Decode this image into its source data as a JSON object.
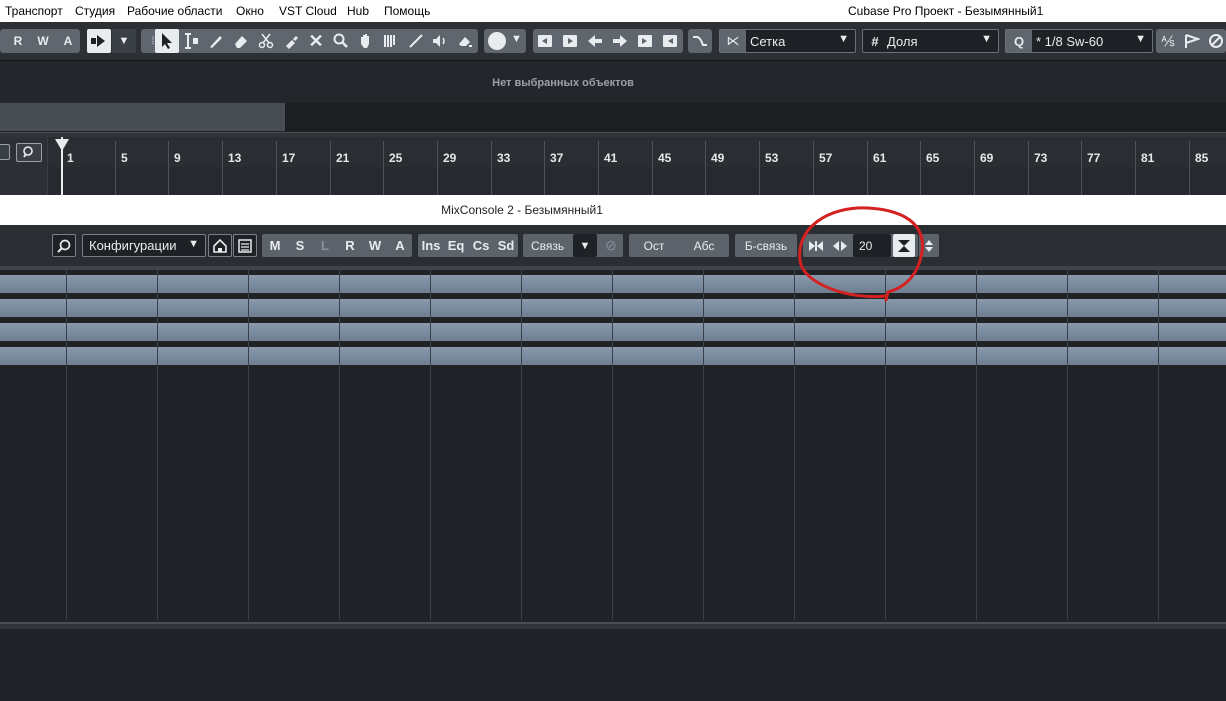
{
  "menubar": {
    "items": [
      "Транспорт",
      "Студия",
      "Рабочие области",
      "Окно",
      "VST Cloud",
      "Hub",
      "Помощь"
    ],
    "app_title": "Cubase Pro Проект - Безымянный1"
  },
  "toolbar": {
    "rwa": [
      "R",
      "W",
      "A"
    ],
    "grid_type": "Сетка",
    "grid_value": "Доля",
    "quantize_value": "* 1/8  Sw-60",
    "icons": [
      "arrow-icon",
      "range-icon",
      "pencil-icon",
      "eraser-icon",
      "scissors-icon",
      "glue-icon",
      "mute-x-icon",
      "zoom-icon",
      "hand-icon",
      "comp-icon",
      "line-icon",
      "speaker-icon",
      "color-icon"
    ]
  },
  "info_line": {
    "text": "Нет выбранных объектов"
  },
  "ruler": {
    "bars": [
      "1",
      "5",
      "9",
      "13",
      "17",
      "21",
      "25",
      "29",
      "33",
      "37",
      "41",
      "45",
      "49",
      "53",
      "57",
      "61",
      "65",
      "69",
      "73",
      "77",
      "81",
      "85"
    ]
  },
  "mixconsole": {
    "title": "MixConsole 2 - Безымянный1",
    "config_label": "Конфигурации",
    "msl": [
      "M",
      "S",
      "L"
    ],
    "rwa": [
      "R",
      "W",
      "A"
    ],
    "sections": [
      "Ins",
      "Eq",
      "Cs",
      "Sd"
    ],
    "link_label": "Связь",
    "ost_label": "Ост",
    "abs_label": "Абс",
    "qlink_label": "Б-связь",
    "channel_width_value": "20"
  },
  "colors": {
    "accent_annotation": "#d32020",
    "channel_band": "#7d8ea1"
  }
}
